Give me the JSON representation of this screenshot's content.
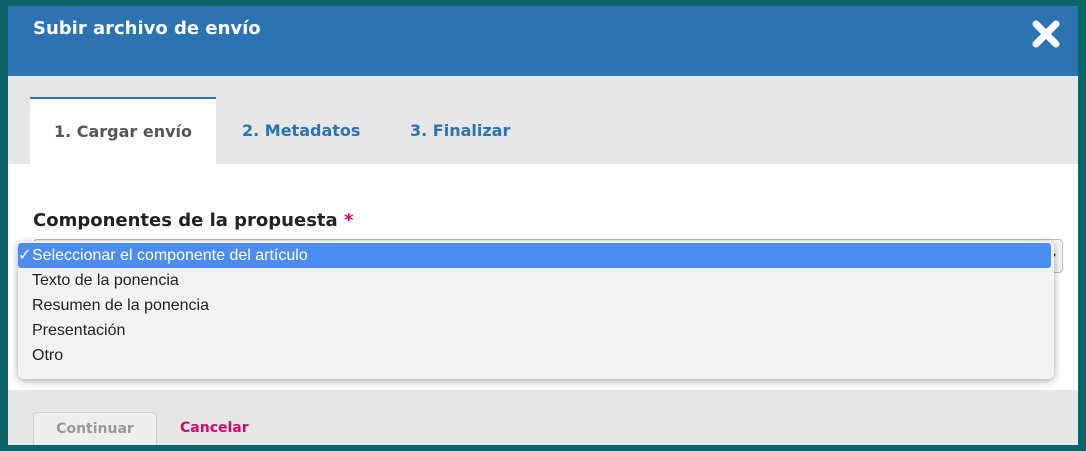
{
  "dialog": {
    "title": "Subir archivo de envío"
  },
  "tabs": [
    {
      "label": "1. Cargar envío",
      "active": true
    },
    {
      "label": "2. Metadatos",
      "active": false
    },
    {
      "label": "3. Finalizar",
      "active": false
    }
  ],
  "field": {
    "label": "Componentes de la propuesta",
    "required_mark": "*"
  },
  "dropdown": {
    "check_mark": "✓",
    "options": [
      {
        "label": "Seleccionar el componente del artículo",
        "selected": true
      },
      {
        "label": "Texto de la ponencia",
        "selected": false
      },
      {
        "label": "Resumen de la ponencia",
        "selected": false
      },
      {
        "label": "Presentación",
        "selected": false
      },
      {
        "label": "Otro",
        "selected": false
      }
    ]
  },
  "footer": {
    "continue_label": "Continuar",
    "cancel_label": "Cancelar"
  },
  "colors": {
    "header": "#2c73b2",
    "accent_pink": "#d00a6c",
    "selection": "#4d8cf0",
    "frame": "#0d6469"
  },
  "icons": {
    "close": "close-icon",
    "select_caret": "chevron-down-icon"
  }
}
